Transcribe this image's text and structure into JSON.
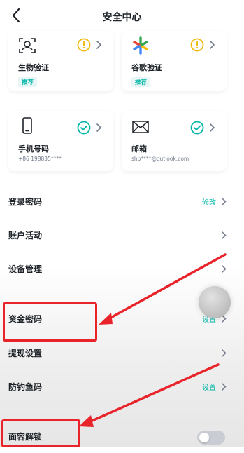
{
  "header": {
    "title": "安全中心",
    "back_icon": "chevron-left-icon"
  },
  "cards": [
    {
      "label": "生物验证",
      "badge": "推荐",
      "icon": "face-scan-icon",
      "status": "warning"
    },
    {
      "label": "谷歌验证",
      "badge": "推荐",
      "icon": "google-auth-icon",
      "status": "warning"
    },
    {
      "label": "手机号码",
      "sub": "+86 198835****",
      "icon": "phone-icon",
      "status": "verified"
    },
    {
      "label": "邮箱",
      "sub": "shb****@outlook.com",
      "icon": "mail-icon",
      "status": "verified"
    }
  ],
  "rows": [
    {
      "label": "登录密码",
      "action": "修改"
    },
    {
      "label": "账户活动",
      "action": ""
    },
    {
      "label": "设备管理",
      "action": ""
    },
    {
      "label": "资金密码",
      "action": "设置"
    },
    {
      "label": "提现设置",
      "action": ""
    },
    {
      "label": "防钓鱼码",
      "action": "设置"
    },
    {
      "label": "面容解锁",
      "toggle": false
    }
  ],
  "colors": {
    "accent": "#02b6a7",
    "warning": "#f0b90b",
    "highlight": "#e8232a",
    "text_primary": "#1e2329",
    "text_secondary": "#707a8a"
  }
}
